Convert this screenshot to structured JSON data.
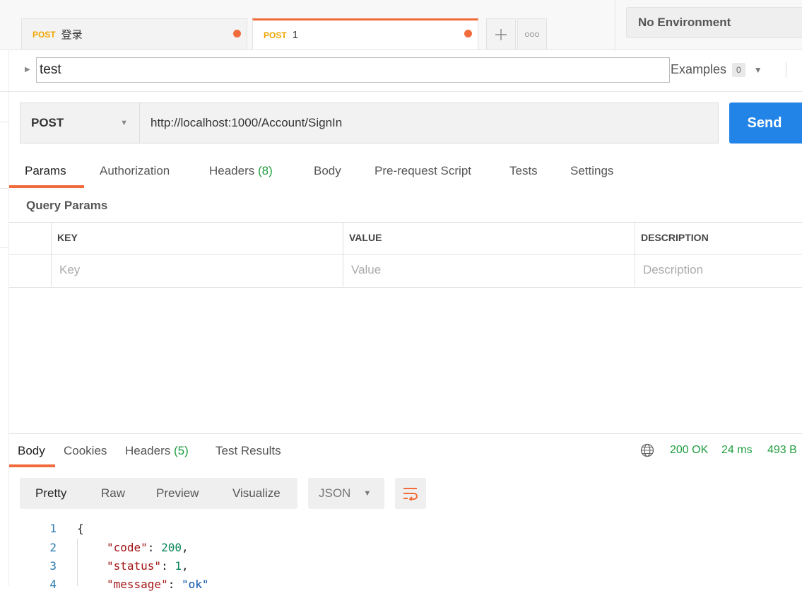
{
  "tabs": [
    {
      "method": "POST",
      "name": "登录"
    },
    {
      "method": "POST",
      "name": "1"
    }
  ],
  "environment": {
    "selected": "No Environment"
  },
  "request": {
    "name": "test",
    "examples_label": "Examples",
    "examples_count": "0",
    "method": "POST",
    "url": "http://localhost:1000/Account/SignIn",
    "send_label": "Send"
  },
  "request_tabs": {
    "params": "Params",
    "authorization": "Authorization",
    "headers": "Headers",
    "headers_count": "(8)",
    "body": "Body",
    "prerequest": "Pre-request Script",
    "tests": "Tests",
    "settings": "Settings"
  },
  "query_params": {
    "title": "Query Params",
    "columns": [
      "KEY",
      "VALUE",
      "DESCRIPTION"
    ],
    "placeholders": [
      "Key",
      "Value",
      "Description"
    ]
  },
  "response": {
    "tabs": {
      "body": "Body",
      "cookies": "Cookies",
      "headers": "Headers",
      "headers_count": "(5)",
      "test_results": "Test Results"
    },
    "status": "200 OK",
    "time": "24 ms",
    "size": "493 B",
    "views": [
      "Pretty",
      "Raw",
      "Preview",
      "Visualize"
    ],
    "format": "JSON",
    "lines": [
      {
        "n": "1",
        "text": "{"
      },
      {
        "n": "2",
        "key": "\"code\"",
        "value": "200",
        "tail": ","
      },
      {
        "n": "3",
        "key": "\"status\"",
        "value": "1",
        "tail": ","
      },
      {
        "n": "4",
        "key": "\"message\"",
        "value": "\"ok\"",
        "tail": ""
      }
    ]
  },
  "colors": {
    "accent": "#f26b3a",
    "send": "#2384e8",
    "ok": "#1f9d3f",
    "method": "#f0a500"
  }
}
